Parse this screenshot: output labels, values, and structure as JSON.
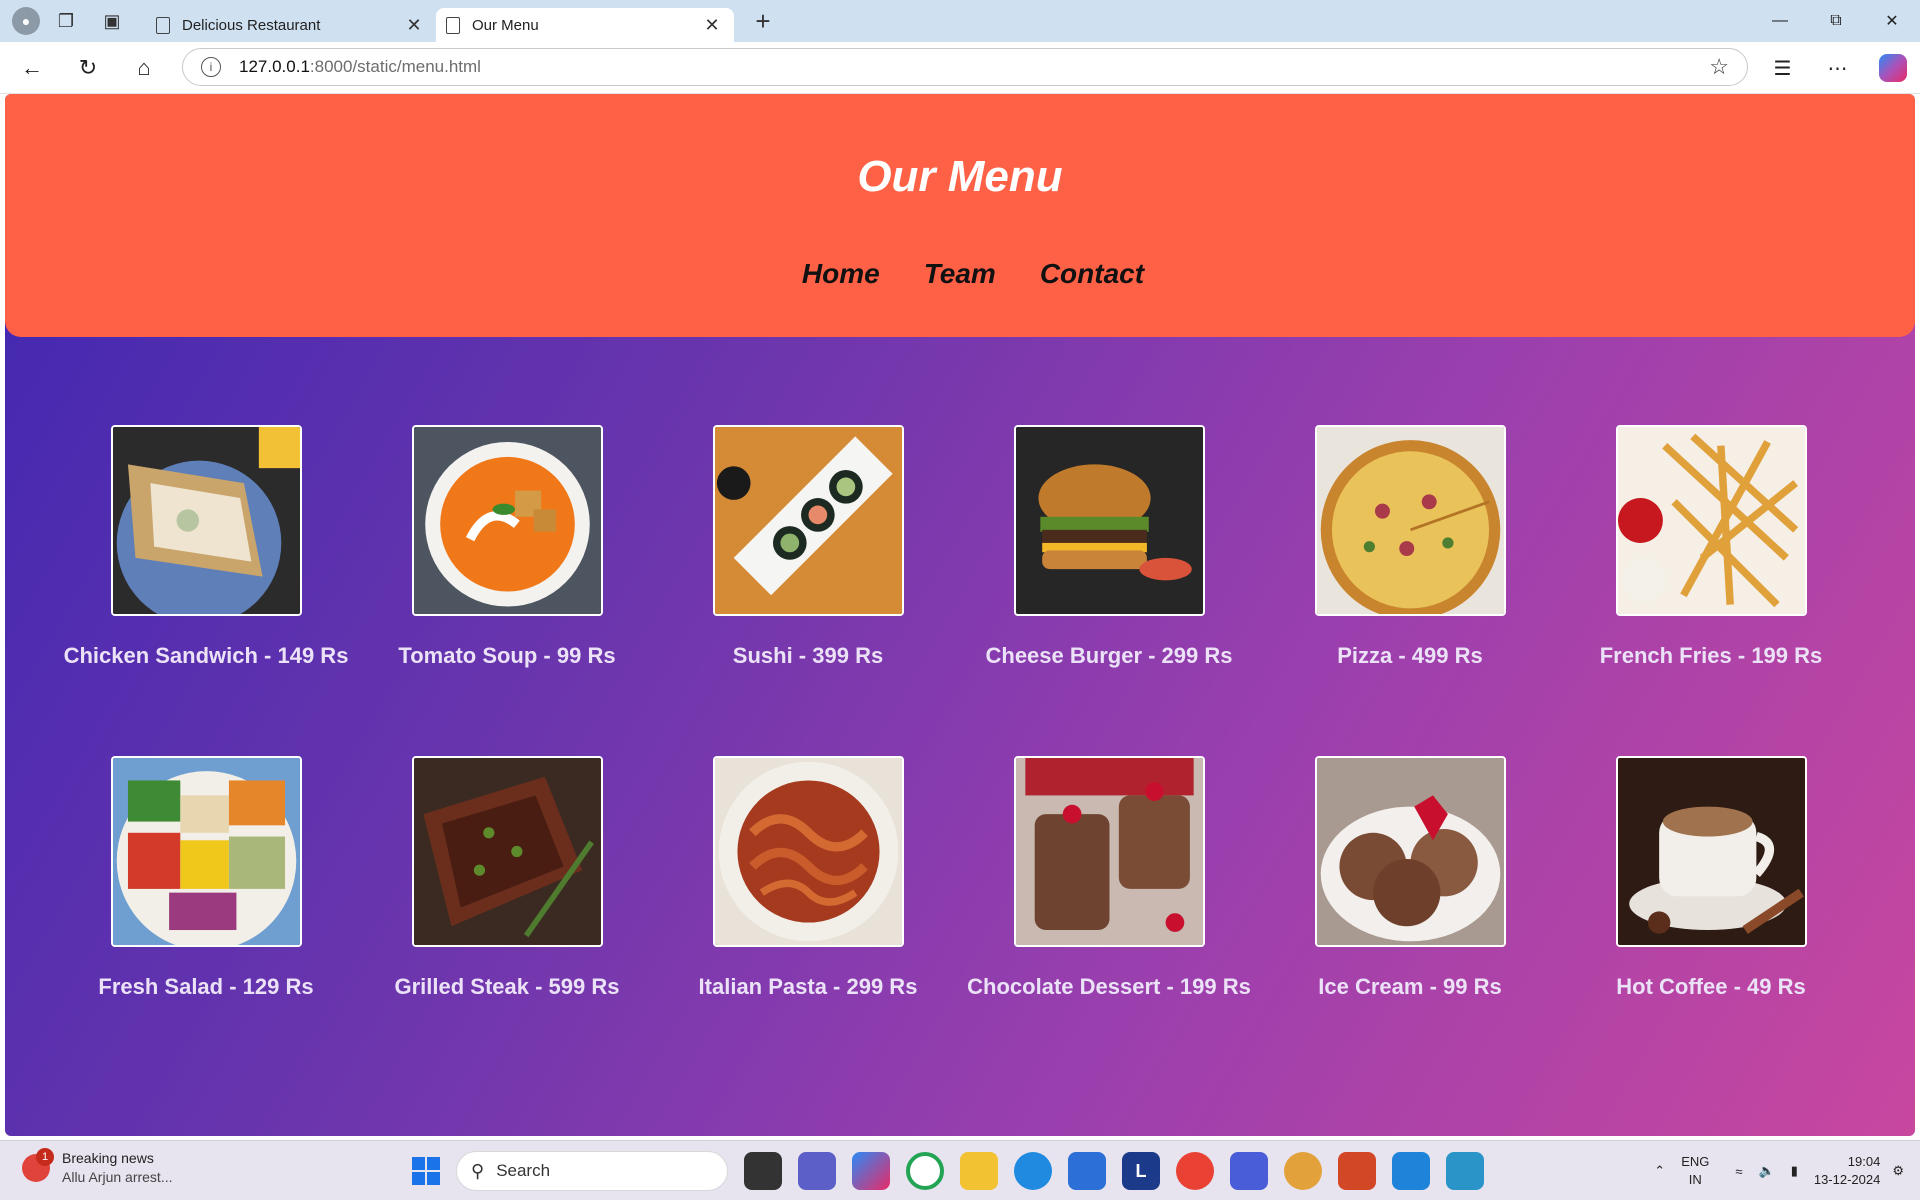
{
  "browser": {
    "tabs": [
      {
        "title": "Delicious Restaurant",
        "active": false
      },
      {
        "title": "Our Menu",
        "active": true
      }
    ],
    "url_host": "127.0.0.1",
    "url_path": ":8000/static/menu.html"
  },
  "page": {
    "title": "Our Menu",
    "nav": [
      "Home",
      "Team",
      "Contact"
    ],
    "items": [
      {
        "label": "Chicken Sandwich - 149 Rs",
        "icon": "sandwich-image"
      },
      {
        "label": "Tomato Soup - 99 Rs",
        "icon": "soup-image"
      },
      {
        "label": "Sushi - 399 Rs",
        "icon": "sushi-image"
      },
      {
        "label": "Cheese Burger - 299 Rs",
        "icon": "burger-image"
      },
      {
        "label": "Pizza - 499 Rs",
        "icon": "pizza-image"
      },
      {
        "label": "French Fries - 199 Rs",
        "icon": "fries-image"
      },
      {
        "label": "Fresh Salad - 129 Rs",
        "icon": "salad-image"
      },
      {
        "label": "Grilled Steak - 599 Rs",
        "icon": "steak-image"
      },
      {
        "label": "Italian Pasta - 299 Rs",
        "icon": "pasta-image"
      },
      {
        "label": "Chocolate Dessert - 199 Rs",
        "icon": "dessert-image"
      },
      {
        "label": "Ice Cream - 99 Rs",
        "icon": "icecream-image"
      },
      {
        "label": "Hot Coffee - 49 Rs",
        "icon": "coffee-image"
      }
    ],
    "colors": {
      "header": "#ff6147",
      "gradient_start": "#3f27b1",
      "gradient_end": "#c8479f"
    }
  },
  "taskbar": {
    "news_title": "Breaking news",
    "news_sub": "Allu Arjun arrest...",
    "news_badge": "1",
    "search_label": "Search",
    "lang_1": "ENG",
    "lang_2": "IN",
    "time": "19:04",
    "date": "13-12-2024"
  }
}
